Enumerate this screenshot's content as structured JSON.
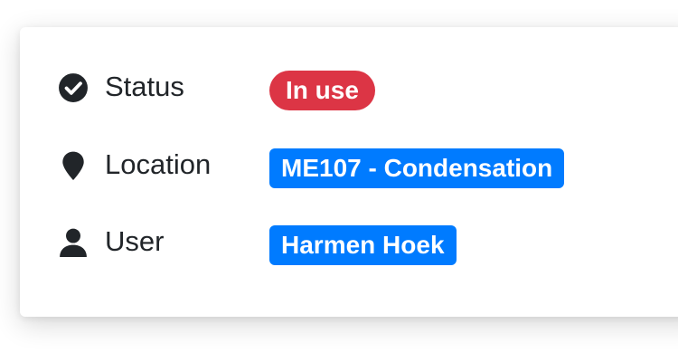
{
  "details": {
    "status": {
      "label": "Status",
      "icon": "check-circle-icon",
      "value": "In use",
      "badge_color": "#dc3545"
    },
    "location": {
      "label": "Location",
      "icon": "map-pin-icon",
      "value": "ME107 - Condensation",
      "badge_color": "#007bff"
    },
    "user": {
      "label": "User",
      "icon": "user-icon",
      "value": "Harmen Hoek",
      "badge_color": "#007bff"
    }
  },
  "colors": {
    "text": "#212529",
    "danger": "#dc3545",
    "primary": "#007bff"
  }
}
